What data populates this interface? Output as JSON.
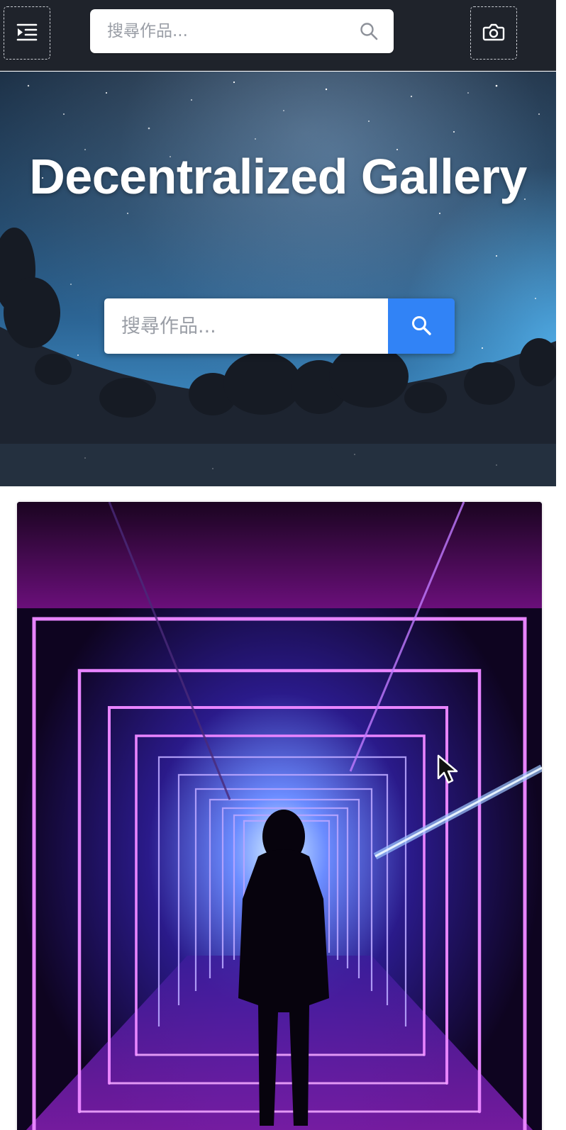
{
  "topbar": {
    "menu_icon": "menu-indent-icon",
    "search_placeholder": "搜尋作品...",
    "search_icon": "search-icon",
    "camera_icon": "camera-icon"
  },
  "hero": {
    "title": "Decentralized Gallery",
    "search_placeholder": "搜尋作品...",
    "search_button_icon": "search-icon",
    "accent_color": "#3183f6"
  },
  "gallery": {
    "cards": [
      {
        "image": "neon-tunnel-silhouette"
      }
    ]
  },
  "colors": {
    "topbar_bg": "#1f232b",
    "button_blue": "#3183f6",
    "neon_purple": "#c85cff"
  }
}
